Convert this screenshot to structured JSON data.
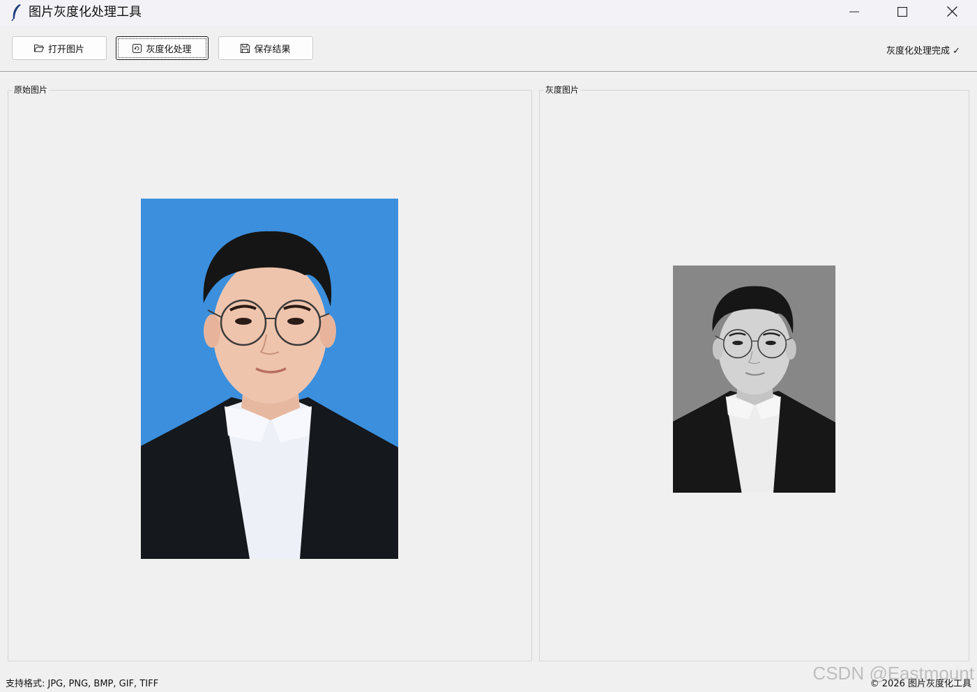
{
  "window": {
    "title": "图片灰度化处理工具",
    "icon": "feather-icon",
    "controls": [
      "minimize-icon",
      "maximize-icon",
      "close-icon"
    ]
  },
  "toolbar": {
    "open_label": "打开图片",
    "open_icon": "folder-open-icon",
    "gray_label": "灰度化处理",
    "gray_icon": "image-process-icon",
    "save_label": "保存结果",
    "save_icon": "floppy-disk-icon",
    "status": "灰度化处理完成 ✓"
  },
  "panels": {
    "original_label": "原始图片",
    "gray_label": "灰度图片"
  },
  "footer": {
    "formats": "支持格式: JPG, PNG, BMP, GIF, TIFF",
    "copyright": "© 2026 图片灰度化工具",
    "watermark": "CSDN @Eastmount"
  },
  "colors": {
    "photo_background": "#3b8fdd",
    "gray_background": "#878787",
    "window_background": "#f0f0f0"
  }
}
